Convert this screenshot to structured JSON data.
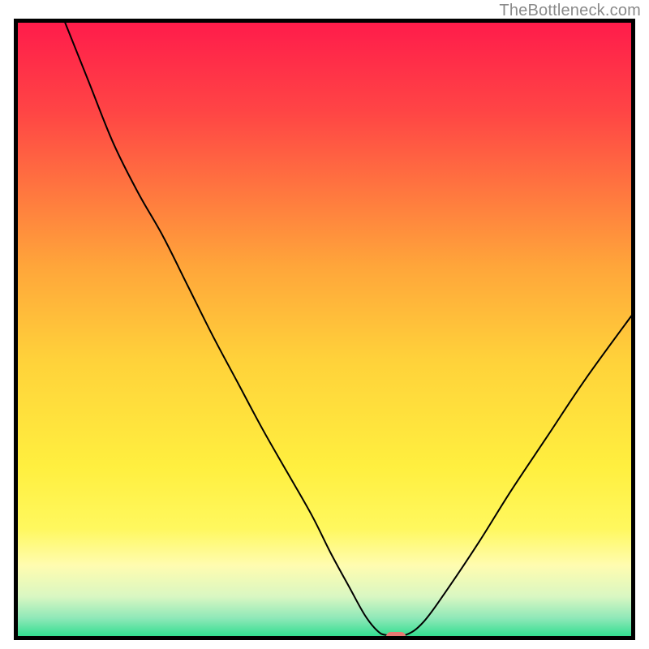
{
  "watermark": "TheBottleneck.com",
  "chart_data": {
    "type": "line",
    "title": "",
    "xlabel": "",
    "ylabel": "",
    "xlim": [
      0,
      100
    ],
    "ylim": [
      0,
      100
    ],
    "grid": false,
    "background": {
      "type": "vertical-gradient",
      "stops": [
        {
          "offset": 0.0,
          "color": "#ff1a4b"
        },
        {
          "offset": 0.15,
          "color": "#ff4545"
        },
        {
          "offset": 0.4,
          "color": "#ffa63a"
        },
        {
          "offset": 0.55,
          "color": "#ffd23a"
        },
        {
          "offset": 0.72,
          "color": "#ffef3f"
        },
        {
          "offset": 0.82,
          "color": "#fff85e"
        },
        {
          "offset": 0.88,
          "color": "#fffcb0"
        },
        {
          "offset": 0.93,
          "color": "#d9f7c2"
        },
        {
          "offset": 0.965,
          "color": "#8ee8b8"
        },
        {
          "offset": 1.0,
          "color": "#1fdc87"
        }
      ]
    },
    "series": [
      {
        "name": "bottleneck-curve",
        "color": "#000000",
        "width": 2,
        "x": [
          8.0,
          12.0,
          16.0,
          20.0,
          24.0,
          28.0,
          32.0,
          36.0,
          40.0,
          44.0,
          48.0,
          51.0,
          54.0,
          56.5,
          58.5,
          60.0,
          63.0,
          66.0,
          70.0,
          75.0,
          80.0,
          86.0,
          92.0,
          100.0
        ],
        "y": [
          100.0,
          90.0,
          80.0,
          72.0,
          65.0,
          57.0,
          49.0,
          41.5,
          34.0,
          27.0,
          20.0,
          14.0,
          8.5,
          4.0,
          1.5,
          0.8,
          0.8,
          3.0,
          8.5,
          16.0,
          24.0,
          33.0,
          42.0,
          53.0
        ]
      }
    ],
    "markers": [
      {
        "name": "optimal-point",
        "shape": "rounded-rect",
        "cx": 61.5,
        "cy": 0.5,
        "w": 3.2,
        "h": 1.6,
        "color": "#e77a74"
      }
    ]
  }
}
